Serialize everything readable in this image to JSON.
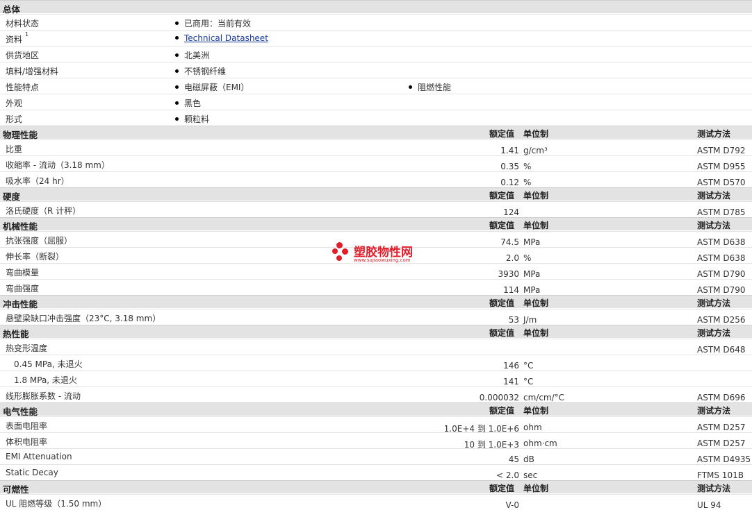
{
  "sections": {
    "general": {
      "title": "总体",
      "rows": [
        {
          "label": "材料状态",
          "items": [
            "已商用：当前有效"
          ]
        },
        {
          "label": "资料",
          "sup": "1",
          "items": [
            "Technical Datasheet"
          ]
        },
        {
          "label": "供货地区",
          "items": [
            "北美洲"
          ]
        },
        {
          "label": "填料/增强材料",
          "items": [
            "不锈钢纤维"
          ]
        },
        {
          "label": "性能特点",
          "items": [
            "电磁屏蔽（EMI）",
            "阻燃性能"
          ]
        },
        {
          "label": "外观",
          "items": [
            "黑色"
          ]
        },
        {
          "label": "形式",
          "items": [
            "颗粒料"
          ]
        }
      ]
    },
    "col_headers": {
      "nominal": "额定值",
      "unit": "单位制",
      "test": "测试方法"
    },
    "physical": {
      "title": "物理性能",
      "rows": [
        {
          "label": "比重",
          "value": "1.41",
          "unit": "g/cm³",
          "method": "ASTM D792"
        },
        {
          "label": "收缩率 - 流动（3.18 mm）",
          "value": "0.35",
          "unit": "%",
          "method": "ASTM D955"
        },
        {
          "label": "吸水率（24 hr）",
          "value": "0.12",
          "unit": "%",
          "method": "ASTM D570"
        }
      ]
    },
    "hardness": {
      "title": "硬度",
      "rows": [
        {
          "label": "洛氏硬度（R 计秤）",
          "value": "124",
          "unit": "",
          "method": "ASTM D785"
        }
      ]
    },
    "mechanical": {
      "title": "机械性能",
      "rows": [
        {
          "label": "抗张强度（屈服）",
          "value": "74.5",
          "unit": "MPa",
          "method": "ASTM D638"
        },
        {
          "label": "伸长率（断裂）",
          "value": "2.0",
          "unit": "%",
          "method": "ASTM D638"
        },
        {
          "label": "弯曲模量",
          "value": "3930",
          "unit": "MPa",
          "method": "ASTM D790"
        },
        {
          "label": "弯曲强度",
          "value": "114",
          "unit": "MPa",
          "method": "ASTM D790"
        }
      ]
    },
    "impact": {
      "title": "冲击性能",
      "rows": [
        {
          "label": "悬壁梁缺口冲击强度（23°C, 3.18 mm）",
          "value": "53",
          "unit": "J/m",
          "method": "ASTM D256"
        }
      ]
    },
    "thermal": {
      "title": "热性能",
      "rows": [
        {
          "label": "热变形温度",
          "value": "",
          "unit": "",
          "method": "ASTM D648"
        },
        {
          "label": "0.45 MPa, 未退火",
          "indent": true,
          "value": "146",
          "unit": "°C",
          "method": ""
        },
        {
          "label": "1.8 MPa, 未退火",
          "indent": true,
          "value": "141",
          "unit": "°C",
          "method": ""
        },
        {
          "label": "线形膨胀系数 - 流动",
          "value": "0.000032",
          "unit": "cm/cm/°C",
          "method": "ASTM D696"
        }
      ]
    },
    "electrical": {
      "title": "电气性能",
      "rows": [
        {
          "label": "表面电阻率",
          "value": "1.0E+4 到  1.0E+6",
          "unit": "ohm",
          "method": "ASTM D257"
        },
        {
          "label": "体积电阻率",
          "value": "10 到  1.0E+3",
          "unit": "ohm·cm",
          "method": "ASTM D257"
        },
        {
          "label": "EMI Attenuation",
          "value": "45",
          "unit": "dB",
          "method": "ASTM D4935"
        },
        {
          "label": "Static Decay",
          "value": "< 2.0",
          "unit": "sec",
          "method": "FTMS 101B"
        }
      ]
    },
    "flammability": {
      "title": "可燃性",
      "rows": [
        {
          "label": "UL 阻燃等级（1.50 mm）",
          "value": "V-0",
          "unit": "",
          "method": "UL 94"
        }
      ]
    }
  },
  "watermark": {
    "cn": "塑胶物性网",
    "en": "www.sujiaowuxing.com"
  },
  "colors": {
    "header_bg": "#e3e3e3",
    "link": "#1a3d9c",
    "watermark": "#e11d2a"
  }
}
